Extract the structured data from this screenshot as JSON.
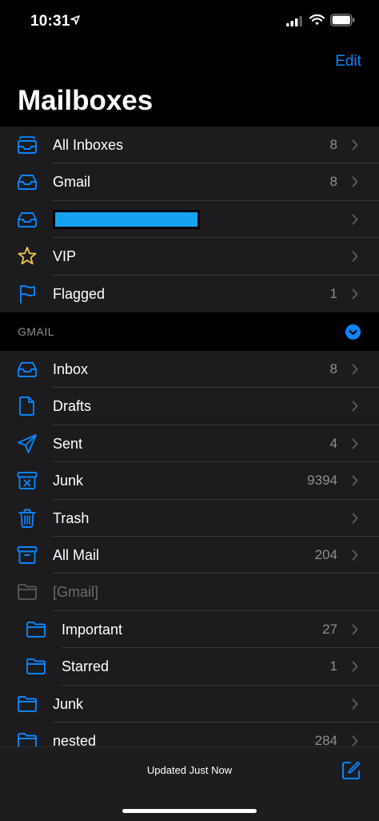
{
  "status_bar": {
    "time": "10:31"
  },
  "header": {
    "edit_label": "Edit",
    "title": "Mailboxes"
  },
  "favorites": [
    {
      "label": "All Inboxes",
      "count": "8",
      "icon": "all-inboxes-icon"
    },
    {
      "label": "Gmail",
      "count": "8",
      "icon": "inbox-icon"
    },
    {
      "label": "",
      "count": "",
      "icon": "inbox-icon",
      "redacted": true
    },
    {
      "label": "VIP",
      "count": "",
      "icon": "star-icon"
    },
    {
      "label": "Flagged",
      "count": "1",
      "icon": "flag-icon"
    }
  ],
  "account_section": {
    "label": "GMAIL"
  },
  "folders": [
    {
      "label": "Inbox",
      "count": "8",
      "icon": "inbox-icon"
    },
    {
      "label": "Drafts",
      "count": "",
      "icon": "document-icon"
    },
    {
      "label": "Sent",
      "count": "4",
      "icon": "paper-plane-icon"
    },
    {
      "label": "Junk",
      "count": "9394",
      "icon": "junk-box-icon"
    },
    {
      "label": "Trash",
      "count": "",
      "icon": "trash-icon"
    },
    {
      "label": "All Mail",
      "count": "204",
      "icon": "archive-box-icon"
    },
    {
      "label": "[Gmail]",
      "count": "",
      "icon": "folder-icon"
    },
    {
      "label": "Important",
      "count": "27",
      "icon": "folder-icon"
    },
    {
      "label": "Starred",
      "count": "1",
      "icon": "folder-icon"
    },
    {
      "label": "Junk",
      "count": "",
      "icon": "folder-icon"
    },
    {
      "label": "nested",
      "count": "284",
      "icon": "folder-icon"
    }
  ],
  "toolbar": {
    "status": "Updated Just Now",
    "compose_icon": "compose-icon"
  },
  "colors": {
    "accent": "#0a84ff",
    "star": "#f5c84c",
    "row_bg": "#1c1c1e",
    "redaction": "#16a2ee"
  }
}
